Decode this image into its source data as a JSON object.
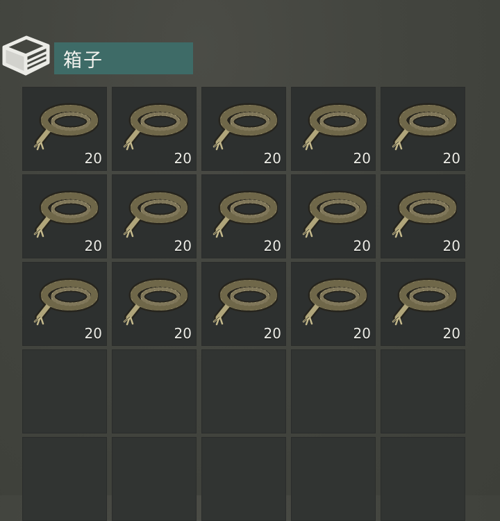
{
  "container": {
    "title": "箱子",
    "icon": "stacked-box-icon"
  },
  "colors": {
    "title_bar": "#3e6b67",
    "slot_background": "#2d302f",
    "rope": "#b6a97c"
  },
  "slots": [
    {
      "item": "rope",
      "icon": "rope-coil-icon",
      "quantity": "20"
    },
    {
      "item": "rope",
      "icon": "rope-coil-icon",
      "quantity": "20"
    },
    {
      "item": "rope",
      "icon": "rope-coil-icon",
      "quantity": "20"
    },
    {
      "item": "rope",
      "icon": "rope-coil-icon",
      "quantity": "20"
    },
    {
      "item": "rope",
      "icon": "rope-coil-icon",
      "quantity": "20"
    },
    {
      "item": "rope",
      "icon": "rope-coil-icon",
      "quantity": "20"
    },
    {
      "item": "rope",
      "icon": "rope-coil-icon",
      "quantity": "20"
    },
    {
      "item": "rope",
      "icon": "rope-coil-icon",
      "quantity": "20"
    },
    {
      "item": "rope",
      "icon": "rope-coil-icon",
      "quantity": "20"
    },
    {
      "item": "rope",
      "icon": "rope-coil-icon",
      "quantity": "20"
    },
    {
      "item": "rope",
      "icon": "rope-coil-icon",
      "quantity": "20"
    },
    {
      "item": "rope",
      "icon": "rope-coil-icon",
      "quantity": "20"
    },
    {
      "item": "rope",
      "icon": "rope-coil-icon",
      "quantity": "20"
    },
    {
      "item": "rope",
      "icon": "rope-coil-icon",
      "quantity": "20"
    },
    {
      "item": "rope",
      "icon": "rope-coil-icon",
      "quantity": "20"
    },
    {
      "item": null
    },
    {
      "item": null
    },
    {
      "item": null
    },
    {
      "item": null
    },
    {
      "item": null
    },
    {
      "item": null
    },
    {
      "item": null
    },
    {
      "item": null
    },
    {
      "item": null
    },
    {
      "item": null
    }
  ]
}
